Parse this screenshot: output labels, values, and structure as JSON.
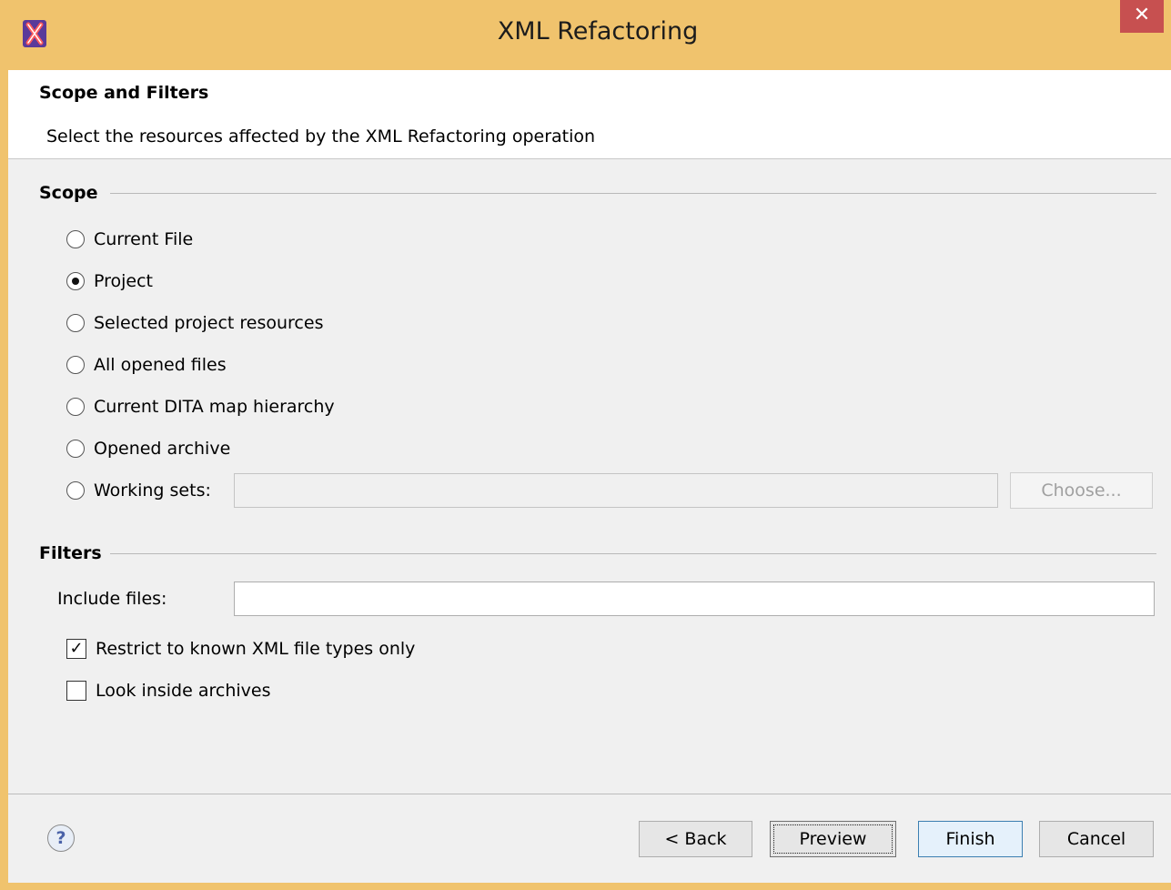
{
  "window": {
    "title": "XML Refactoring",
    "close_symbol": "✕",
    "app_icon": "oxygen-x-icon"
  },
  "header": {
    "title": "Scope and Filters",
    "description": "Select the resources affected by the XML Refactoring operation"
  },
  "scope": {
    "title": "Scope",
    "options": [
      {
        "label": "Current File",
        "checked": false
      },
      {
        "label": "Project",
        "checked": true
      },
      {
        "label": "Selected project resources",
        "checked": false
      },
      {
        "label": "All opened files",
        "checked": false
      },
      {
        "label": "Current DITA map hierarchy",
        "checked": false
      },
      {
        "label": "Opened archive",
        "checked": false
      },
      {
        "label": "Working sets:",
        "checked": false
      }
    ],
    "working_sets_value": "",
    "choose_label": "Choose..."
  },
  "filters": {
    "title": "Filters",
    "include_label": "Include files:",
    "include_value": "",
    "restrict_label": "Restrict to known XML file types only",
    "restrict_checked": true,
    "archives_label": "Look inside archives",
    "archives_checked": false
  },
  "footer": {
    "help_symbol": "?",
    "back_label": "< Back",
    "preview_label": "Preview",
    "finish_label": "Finish",
    "cancel_label": "Cancel"
  }
}
